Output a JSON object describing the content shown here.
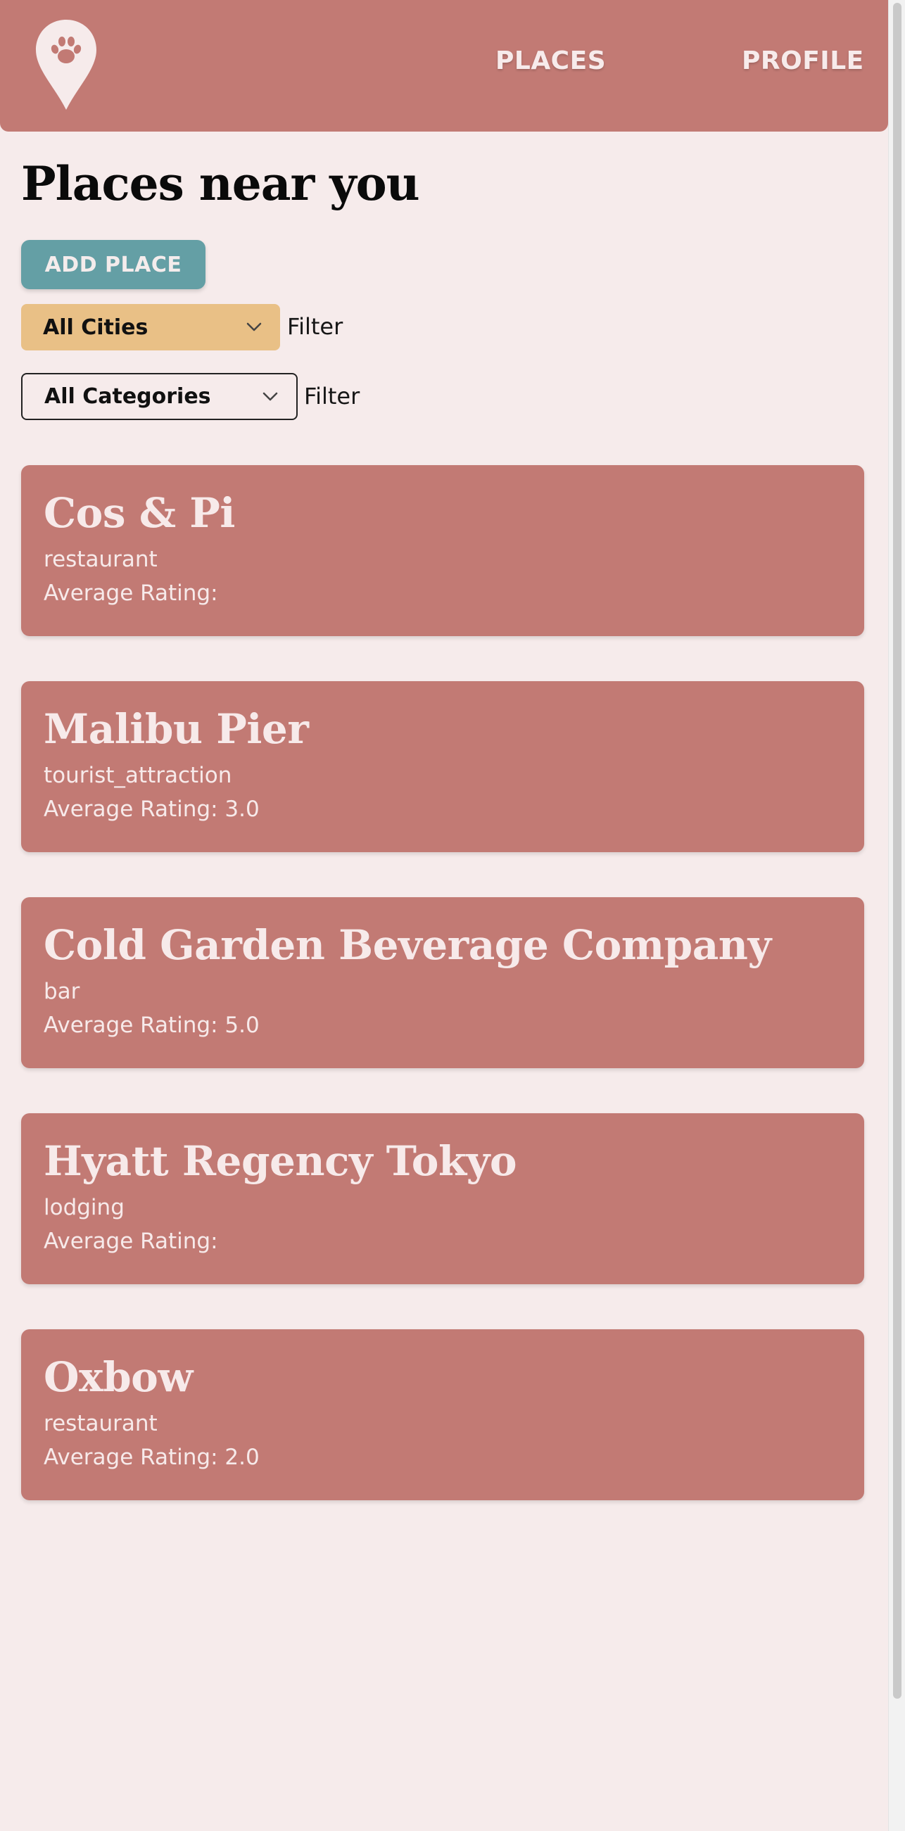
{
  "header": {
    "logo_icon": "map-pin-paw-icon",
    "nav": {
      "places_label": "PLACES",
      "profile_label": "PROFILE"
    }
  },
  "main": {
    "title": "Places near you",
    "add_place_label": "ADD PLACE",
    "city_filter": {
      "selected": "All Cities",
      "filter_label": "Filter"
    },
    "category_filter": {
      "selected": "All Categories",
      "filter_label": "Filter"
    },
    "places": [
      {
        "name": "Cos & Pi",
        "category": "restaurant",
        "rating_text": "Average Rating:"
      },
      {
        "name": "Malibu Pier",
        "category": "tourist_attraction",
        "rating_text": "Average Rating: 3.0"
      },
      {
        "name": "Cold Garden Beverage Company",
        "category": "bar",
        "rating_text": "Average Rating: 5.0"
      },
      {
        "name": "Hyatt Regency Tokyo",
        "category": "lodging",
        "rating_text": "Average Rating:"
      },
      {
        "name": "Oxbow",
        "category": "restaurant",
        "rating_text": "Average Rating: 2.0"
      }
    ]
  },
  "colors": {
    "background": "#f6ebeb",
    "header": "#c27a74",
    "card": "#c27a74",
    "add_button": "#649fa5",
    "city_select": "#e9c086",
    "light_text": "#f7eaea"
  }
}
